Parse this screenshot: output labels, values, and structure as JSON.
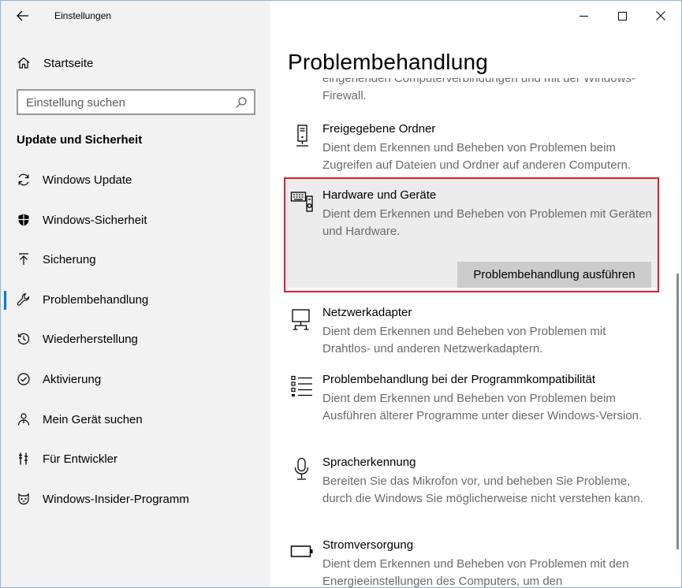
{
  "window": {
    "app_title": "Einstellungen"
  },
  "sidebar": {
    "home_label": "Startseite",
    "search_placeholder": "Einstellung suchen",
    "section_title": "Update und Sicherheit",
    "items": [
      {
        "label": "Windows Update",
        "icon": "refresh-icon"
      },
      {
        "label": "Windows-Sicherheit",
        "icon": "shield-icon"
      },
      {
        "label": "Sicherung",
        "icon": "upload-icon"
      },
      {
        "label": "Problembehandlung",
        "icon": "wrench-icon",
        "active": true
      },
      {
        "label": "Wiederherstellung",
        "icon": "restore-icon"
      },
      {
        "label": "Aktivierung",
        "icon": "check-circle-icon"
      },
      {
        "label": "Mein Gerät suchen",
        "icon": "person-pin-icon"
      },
      {
        "label": "Für Entwickler",
        "icon": "developer-icon"
      },
      {
        "label": "Windows-Insider-Programm",
        "icon": "insider-icon"
      }
    ]
  },
  "main": {
    "page_title": "Problembehandlung",
    "partial_item": {
      "desc": "eingehenden Computerverbindungen und mit der Windows-Firewall."
    },
    "items": [
      {
        "title": "Freigegebene Ordner",
        "desc": "Dient dem Erkennen und Beheben von Problemen beim Zugreifen auf Dateien und Ordner auf anderen Computern.",
        "icon": "server-icon"
      },
      {
        "title": "Hardware und Geräte",
        "desc": "Dient dem Erkennen und Beheben von Problemen mit Geräten und Hardware.",
        "icon": "hardware-icon",
        "expanded": true
      },
      {
        "title": "Netzwerkadapter",
        "desc": "Dient dem Erkennen und Beheben von Problemen mit Drahtlos- und anderen Netzwerkadaptern.",
        "icon": "network-adapter-icon"
      },
      {
        "title": "Problembehandlung bei der Programmkompatibilität",
        "desc": "Dient dem Erkennen und Beheben von Problemen beim Ausführen älterer Programme unter dieser Windows-Version.",
        "icon": "list-icon"
      },
      {
        "title": "Spracherkennung",
        "desc": "Bereiten Sie das Mikrofon vor, und beheben Sie Probleme, durch die Windows Sie möglicherweise nicht verstehen kann.",
        "icon": "microphone-icon"
      },
      {
        "title": "Stromversorgung",
        "desc": "Dient dem Erkennen und Beheben von Problemen mit den Energieeinstellungen des Computers, um den",
        "icon": "battery-icon"
      }
    ],
    "run_button_label": "Problembehandlung ausführen"
  }
}
